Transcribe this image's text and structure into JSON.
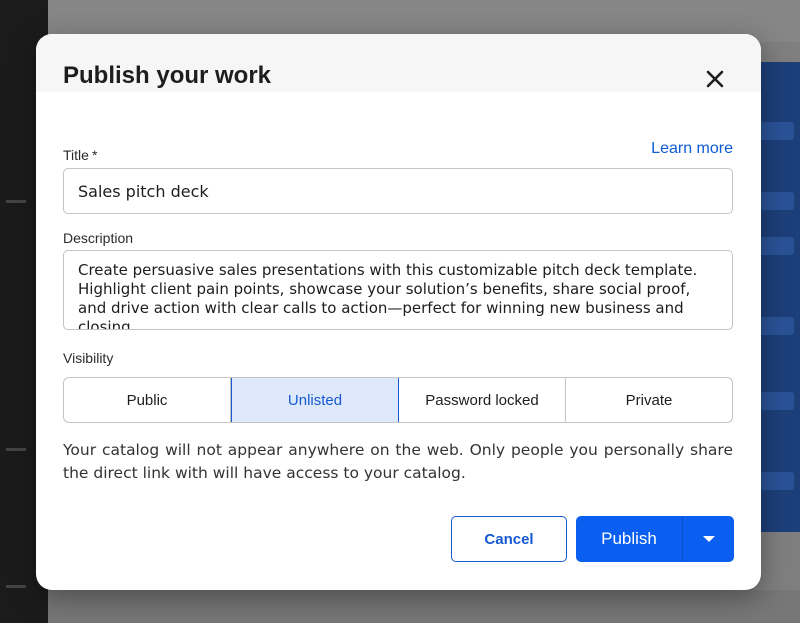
{
  "dialog": {
    "title": "Publish your work",
    "learn_more": "Learn more"
  },
  "title_field": {
    "label": "Title",
    "required_mark": "*",
    "value": "Sales pitch deck"
  },
  "description_field": {
    "label": "Description",
    "value": "Create persuasive sales presentations with this customizable pitch deck template. Highlight client pain points, showcase your solution’s benefits, share social proof, and drive action with clear calls to action—perfect for winning new business and closing"
  },
  "visibility": {
    "label": "Visibility",
    "options": [
      "Public",
      "Unlisted",
      "Password locked",
      "Private"
    ],
    "selected": "Unlisted",
    "help_text": "Your catalog will not appear anywhere on the web. Only people you personally share the direct link with will have access to your catalog."
  },
  "actions": {
    "cancel": "Cancel",
    "publish": "Publish"
  },
  "icons": {
    "close": "close-icon",
    "dropdown": "chevron-down-icon"
  },
  "colors": {
    "accent": "#0a5ff0",
    "link": "#0d5bd6",
    "selected_bg": "#dde8fa"
  }
}
